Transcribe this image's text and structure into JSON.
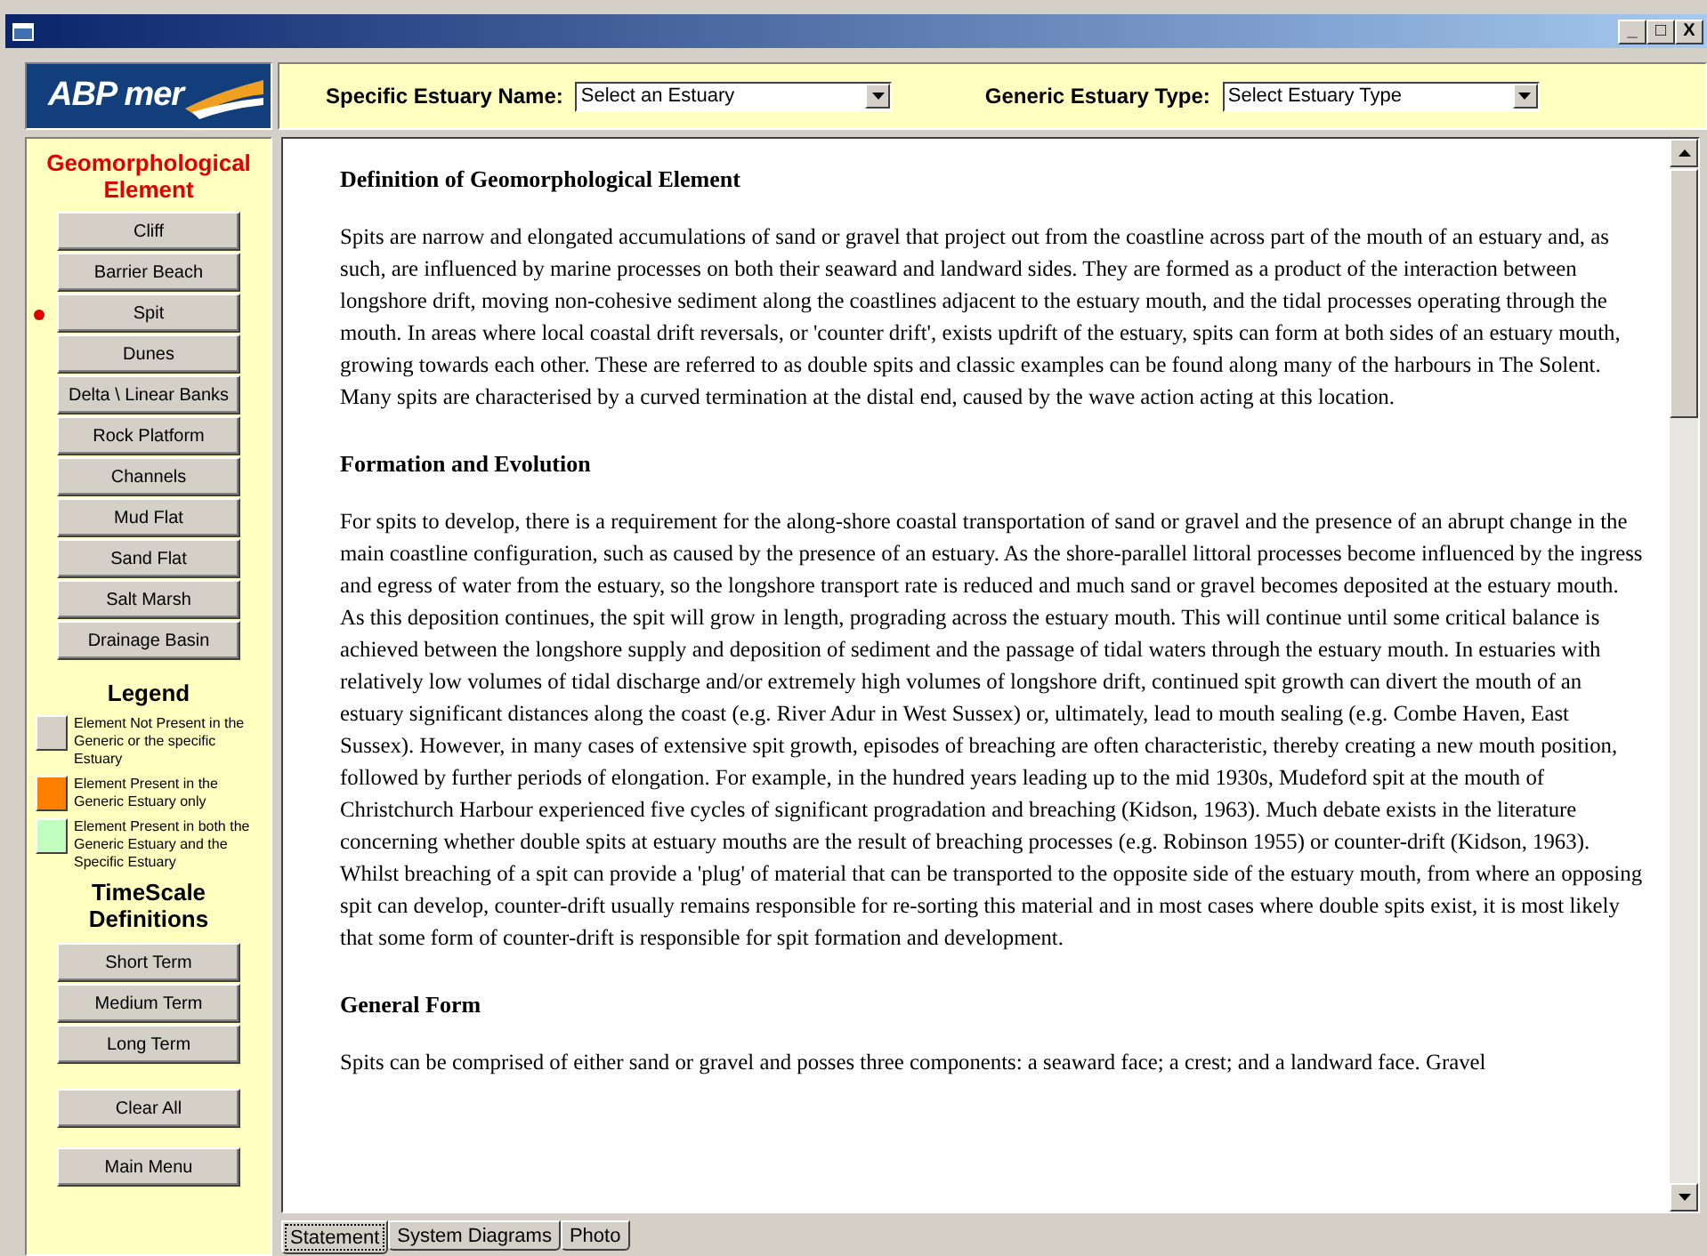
{
  "logo": {
    "text": "ABP mer"
  },
  "window": {
    "controls": [
      "_",
      "□",
      "X"
    ]
  },
  "sidebar": {
    "title": "Geomorphological Element",
    "elements": [
      {
        "label": "Cliff",
        "selected": false
      },
      {
        "label": "Barrier Beach",
        "selected": false
      },
      {
        "label": "Spit",
        "selected": true
      },
      {
        "label": "Dunes",
        "selected": false
      },
      {
        "label": "Delta \\ Linear Banks",
        "selected": false
      },
      {
        "label": "Rock Platform",
        "selected": false
      },
      {
        "label": "Channels",
        "selected": false
      },
      {
        "label": "Mud Flat",
        "selected": false
      },
      {
        "label": "Sand Flat",
        "selected": false
      },
      {
        "label": "Salt Marsh",
        "selected": false
      },
      {
        "label": "Drainage Basin",
        "selected": false
      }
    ],
    "legend_title": "Legend",
    "legend": [
      {
        "color": "#d4d0c8",
        "text": "Element Not Present in the Generic or the specific Estuary"
      },
      {
        "color": "#ff8000",
        "text": "Element Present in the Generic Estuary only"
      },
      {
        "color": "#c0ffc0",
        "text": "Element Present in both the Generic Estuary and the Specific Estuary"
      }
    ],
    "timescale_title": "TimeScale Definitions",
    "timescale_buttons": [
      "Short Term",
      "Medium Term",
      "Long Term"
    ],
    "action_buttons": [
      "Clear All",
      "Main Menu"
    ]
  },
  "filters": [
    {
      "label": "Specific Estuary Name:",
      "value": "Select an Estuary"
    },
    {
      "label": "Generic Estuary Type:",
      "value": "Select Estuary Type"
    }
  ],
  "content": [
    {
      "kind": "heading",
      "text": "Definition of Geomorphological Element"
    },
    {
      "kind": "paragraph",
      "text": "Spits are narrow and elongated accumulations of sand or gravel that project out from the coastline across part of the mouth of an estuary and, as such, are influenced by marine processes on both their seaward and landward sides.  They are formed as a product of the interaction between longshore drift, moving non-cohesive sediment along the coastlines adjacent to the estuary mouth, and the tidal processes operating through the mouth.  In areas where local coastal drift reversals, or 'counter drift', exists updrift of the estuary, spits can form at both sides of an estuary mouth, growing towards each other.  These are referred to as double spits and classic examples can be found along many of the harbours in The Solent.  Many spits are characterised by a curved termination at the distal end, caused by the wave action acting at this location."
    },
    {
      "kind": "heading",
      "text": "Formation and Evolution"
    },
    {
      "kind": "paragraph",
      "text": "For spits to develop, there is a requirement for the along-shore coastal transportation of sand or gravel and the presence of an abrupt change in the main coastline configuration, such as caused by the presence of an estuary.  As the shore-parallel littoral processes become influenced by the ingress and egress of water from the estuary, so the longshore transport rate is reduced and much sand or gravel becomes deposited at the estuary mouth.  As this deposition continues, the spit will grow in length, prograding across the estuary mouth.  This will continue until some critical balance is achieved between the longshore supply and deposition of sediment and the passage of tidal waters through the estuary mouth.  In estuaries with relatively low volumes of tidal discharge and/or extremely high volumes of longshore drift, continued spit growth can divert the mouth of an estuary significant distances along the coast (e.g. River Adur in West Sussex) or, ultimately, lead to mouth sealing (e.g. Combe Haven, East Sussex).  However, in many cases of extensive spit growth, episodes of breaching are often characteristic, thereby creating a new mouth position, followed by further periods of elongation.  For example, in the hundred years leading up to the mid 1930s, Mudeford spit at the mouth of Christchurch Harbour experienced five cycles of significant progradation and breaching (Kidson, 1963).  Much debate exists in the literature concerning whether double spits at estuary mouths are the result of breaching processes (e.g. Robinson 1955) or counter-drift (Kidson, 1963).  Whilst breaching of a spit can provide a 'plug' of material that can be transported to the opposite side of the estuary mouth, from where an opposing spit can develop, counter-drift usually remains responsible for re-sorting this material and in most cases where double spits exist, it is most likely that some form of counter-drift is responsible for spit formation and development."
    },
    {
      "kind": "heading",
      "text": "General Form"
    },
    {
      "kind": "paragraph",
      "text": "Spits can be comprised of either sand or gravel and posses three components: a seaward face; a crest; and a landward face.  Gravel"
    }
  ],
  "tabs": [
    {
      "label": "Statement",
      "selected": true
    },
    {
      "label": "System Diagrams",
      "selected": false
    },
    {
      "label": "Photo",
      "selected": false
    }
  ]
}
